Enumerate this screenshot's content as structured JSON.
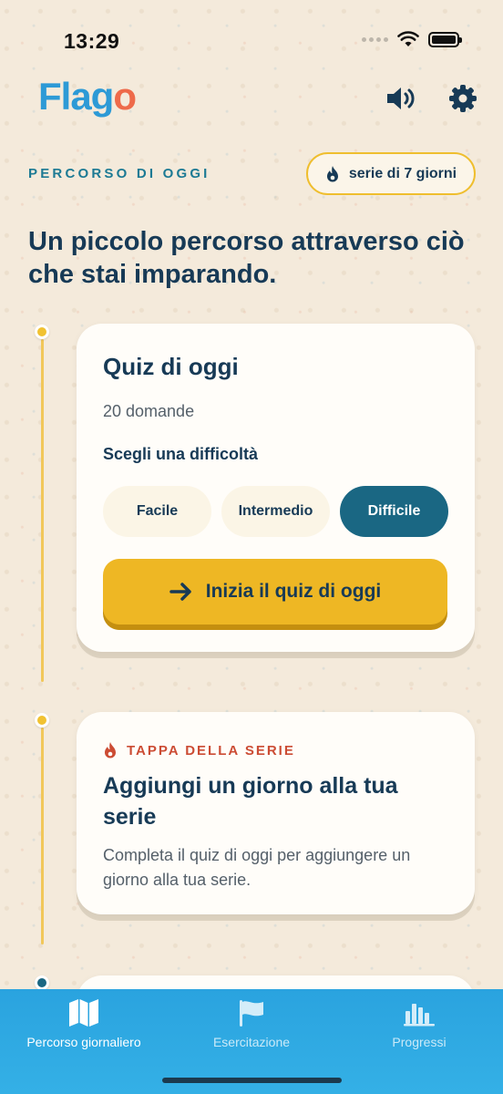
{
  "status": {
    "time": "13:29"
  },
  "app": {
    "logo_main": "Flag",
    "logo_o": "o"
  },
  "header": {
    "sound_icon": "speaker-icon",
    "settings_icon": "gear-icon"
  },
  "section": {
    "label": "PERCORSO DI OGGI",
    "streak_badge": "serie di 7 giorni",
    "headline": "Un piccolo percorso attraverso ciò che stai imparando."
  },
  "quiz_card": {
    "title": "Quiz di oggi",
    "subtitle": "20 domande",
    "difficulty_label": "Scegli una difficoltà",
    "difficulties": [
      "Facile",
      "Intermedio",
      "Difficile"
    ],
    "selected_difficulty": "Difficile",
    "start_button": "Inizia il quiz di oggi"
  },
  "streak_card": {
    "tag": "TAPPA DELLA SERIE",
    "title": "Aggiungi un giorno alla tua serie",
    "text": "Completa il quiz di oggi per aggiungere un giorno alla tua serie."
  },
  "tabs": [
    {
      "label": "Percorso giornaliero",
      "icon": "map-icon",
      "active": true
    },
    {
      "label": "Esercitazione",
      "icon": "flag-icon",
      "active": false
    },
    {
      "label": "Progressi",
      "icon": "bar-chart-icon",
      "active": false
    }
  ],
  "colors": {
    "accent": "#1a6783",
    "brand_blue": "#2d9ad6",
    "brand_orange": "#ee6a4a",
    "cta_yellow": "#eeb724",
    "streak_red": "#cc4c34",
    "tab_bar": "#2aa3df"
  }
}
